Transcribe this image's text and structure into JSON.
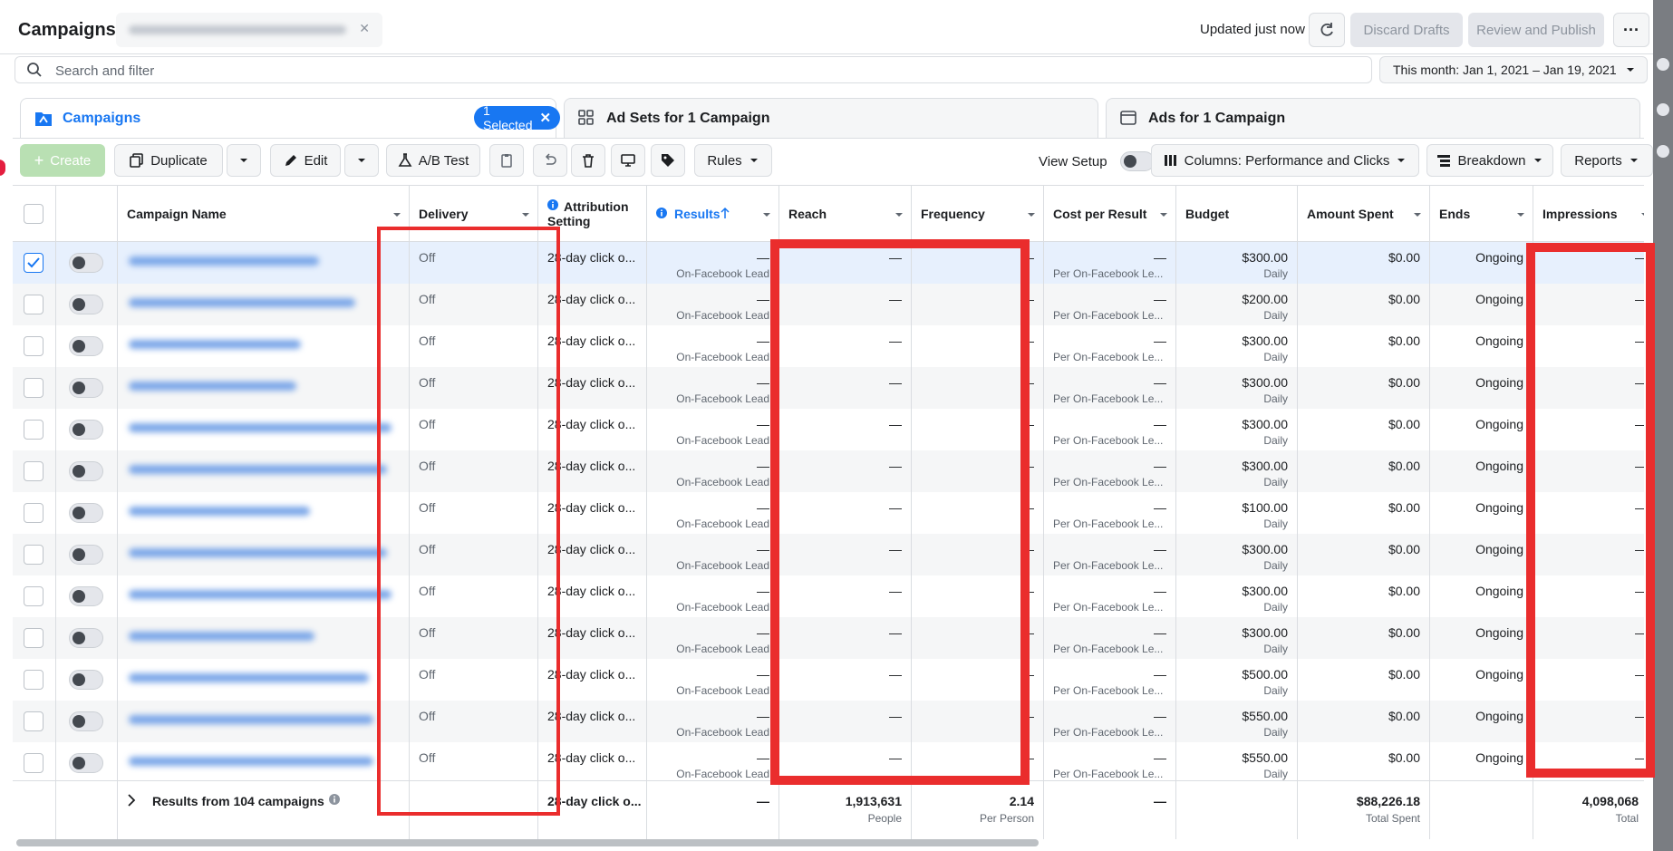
{
  "header": {
    "title": "Campaigns",
    "updated": "Updated just now",
    "discard_label": "Discard Drafts",
    "review_label": "Review and Publish",
    "more_label": "···"
  },
  "search": {
    "placeholder": "Search and filter",
    "date_range": "This month: Jan 1, 2021 – Jan 19, 2021"
  },
  "tabs": {
    "campaigns": "Campaigns",
    "selected_badge": "1 Selected",
    "adsets": "Ad Sets for 1 Campaign",
    "ads": "Ads for 1 Campaign"
  },
  "toolbar": {
    "create": "Create",
    "duplicate": "Duplicate",
    "edit": "Edit",
    "abtest": "A/B Test",
    "rules": "Rules",
    "view_setup": "View Setup",
    "columns": "Columns: Performance and Clicks",
    "breakdown": "Breakdown",
    "reports": "Reports"
  },
  "columns": {
    "name": "Campaign Name",
    "delivery": "Delivery",
    "attribution_1": "Attribution",
    "attribution_2": "Setting",
    "results": "Results",
    "reach": "Reach",
    "frequency": "Frequency",
    "cost": "Cost per Result",
    "budget": "Budget",
    "spent": "Amount Spent",
    "ends": "Ends",
    "impressions": "Impressions"
  },
  "rows": [
    {
      "delivery": "Off",
      "attribution": "28-day click o...",
      "results": "—",
      "results_sub": "On-Facebook Lead",
      "reach": "—",
      "frequency": "—",
      "cost": "—",
      "cost_sub": "Per On-Facebook Le...",
      "budget": "$300.00",
      "budget_sub": "Daily",
      "spent": "$0.00",
      "ends": "Ongoing",
      "impressions": "—"
    },
    {
      "delivery": "Off",
      "attribution": "28-day click o...",
      "results": "—",
      "results_sub": "On-Facebook Lead",
      "reach": "—",
      "frequency": "—",
      "cost": "—",
      "cost_sub": "Per On-Facebook Le...",
      "budget": "$200.00",
      "budget_sub": "Daily",
      "spent": "$0.00",
      "ends": "Ongoing",
      "impressions": "—"
    },
    {
      "delivery": "Off",
      "attribution": "28-day click o...",
      "results": "—",
      "results_sub": "On-Facebook Lead",
      "reach": "—",
      "frequency": "—",
      "cost": "—",
      "cost_sub": "Per On-Facebook Le...",
      "budget": "$300.00",
      "budget_sub": "Daily",
      "spent": "$0.00",
      "ends": "Ongoing",
      "impressions": "—"
    },
    {
      "delivery": "Off",
      "attribution": "28-day click o...",
      "results": "—",
      "results_sub": "On-Facebook Lead",
      "reach": "—",
      "frequency": "—",
      "cost": "—",
      "cost_sub": "Per On-Facebook Le...",
      "budget": "$300.00",
      "budget_sub": "Daily",
      "spent": "$0.00",
      "ends": "Ongoing",
      "impressions": "—"
    },
    {
      "delivery": "Off",
      "attribution": "28-day click o...",
      "results": "—",
      "results_sub": "On-Facebook Lead",
      "reach": "—",
      "frequency": "—",
      "cost": "—",
      "cost_sub": "Per On-Facebook Le...",
      "budget": "$300.00",
      "budget_sub": "Daily",
      "spent": "$0.00",
      "ends": "Ongoing",
      "impressions": "—"
    },
    {
      "delivery": "Off",
      "attribution": "28-day click o...",
      "results": "—",
      "results_sub": "On-Facebook Lead",
      "reach": "—",
      "frequency": "—",
      "cost": "—",
      "cost_sub": "Per On-Facebook Le...",
      "budget": "$300.00",
      "budget_sub": "Daily",
      "spent": "$0.00",
      "ends": "Ongoing",
      "impressions": "—"
    },
    {
      "delivery": "Off",
      "attribution": "28-day click o...",
      "results": "—",
      "results_sub": "On-Facebook Lead",
      "reach": "—",
      "frequency": "—",
      "cost": "—",
      "cost_sub": "Per On-Facebook Le...",
      "budget": "$100.00",
      "budget_sub": "Daily",
      "spent": "$0.00",
      "ends": "Ongoing",
      "impressions": "—"
    },
    {
      "delivery": "Off",
      "attribution": "28-day click o...",
      "results": "—",
      "results_sub": "On-Facebook Lead",
      "reach": "—",
      "frequency": "—",
      "cost": "—",
      "cost_sub": "Per On-Facebook Le...",
      "budget": "$300.00",
      "budget_sub": "Daily",
      "spent": "$0.00",
      "ends": "Ongoing",
      "impressions": "—"
    },
    {
      "delivery": "Off",
      "attribution": "28-day click o...",
      "results": "—",
      "results_sub": "On-Facebook Lead",
      "reach": "—",
      "frequency": "—",
      "cost": "—",
      "cost_sub": "Per On-Facebook Le...",
      "budget": "$300.00",
      "budget_sub": "Daily",
      "spent": "$0.00",
      "ends": "Ongoing",
      "impressions": "—"
    },
    {
      "delivery": "Off",
      "attribution": "28-day click o...",
      "results": "—",
      "results_sub": "On-Facebook Lead",
      "reach": "—",
      "frequency": "—",
      "cost": "—",
      "cost_sub": "Per On-Facebook Le...",
      "budget": "$300.00",
      "budget_sub": "Daily",
      "spent": "$0.00",
      "ends": "Ongoing",
      "impressions": "—"
    },
    {
      "delivery": "Off",
      "attribution": "28-day click o...",
      "results": "—",
      "results_sub": "On-Facebook Lead",
      "reach": "—",
      "frequency": "—",
      "cost": "—",
      "cost_sub": "Per On-Facebook Le...",
      "budget": "$500.00",
      "budget_sub": "Daily",
      "spent": "$0.00",
      "ends": "Ongoing",
      "impressions": "—"
    },
    {
      "delivery": "Off",
      "attribution": "28-day click o...",
      "results": "—",
      "results_sub": "On-Facebook Lead",
      "reach": "—",
      "frequency": "—",
      "cost": "—",
      "cost_sub": "Per On-Facebook Le...",
      "budget": "$550.00",
      "budget_sub": "Daily",
      "spent": "$0.00",
      "ends": "Ongoing",
      "impressions": "—"
    },
    {
      "delivery": "Off",
      "attribution": "28-day click o...",
      "results": "—",
      "results_sub": "On-Facebook Lead",
      "reach": "—",
      "frequency": "—",
      "cost": "—",
      "cost_sub": "Per On-Facebook Le...",
      "budget": "$550.00",
      "budget_sub": "Daily",
      "spent": "$0.00",
      "ends": "Ongoing",
      "impressions": "—"
    }
  ],
  "footer": {
    "label": "Results from 104 campaigns",
    "attribution": "28-day click o...",
    "results": "—",
    "reach": "1,913,631",
    "reach_sub": "People",
    "frequency": "2.14",
    "frequency_sub": "Per Person",
    "cost": "—",
    "spent": "$88,226.18",
    "spent_sub": "Total Spent",
    "impressions": "4,098,068",
    "impressions_sub": "Total"
  },
  "colors": {
    "accent": "#1877f2",
    "annotation": "#ea2d2d",
    "create_disabled": "#b9e0b3"
  }
}
